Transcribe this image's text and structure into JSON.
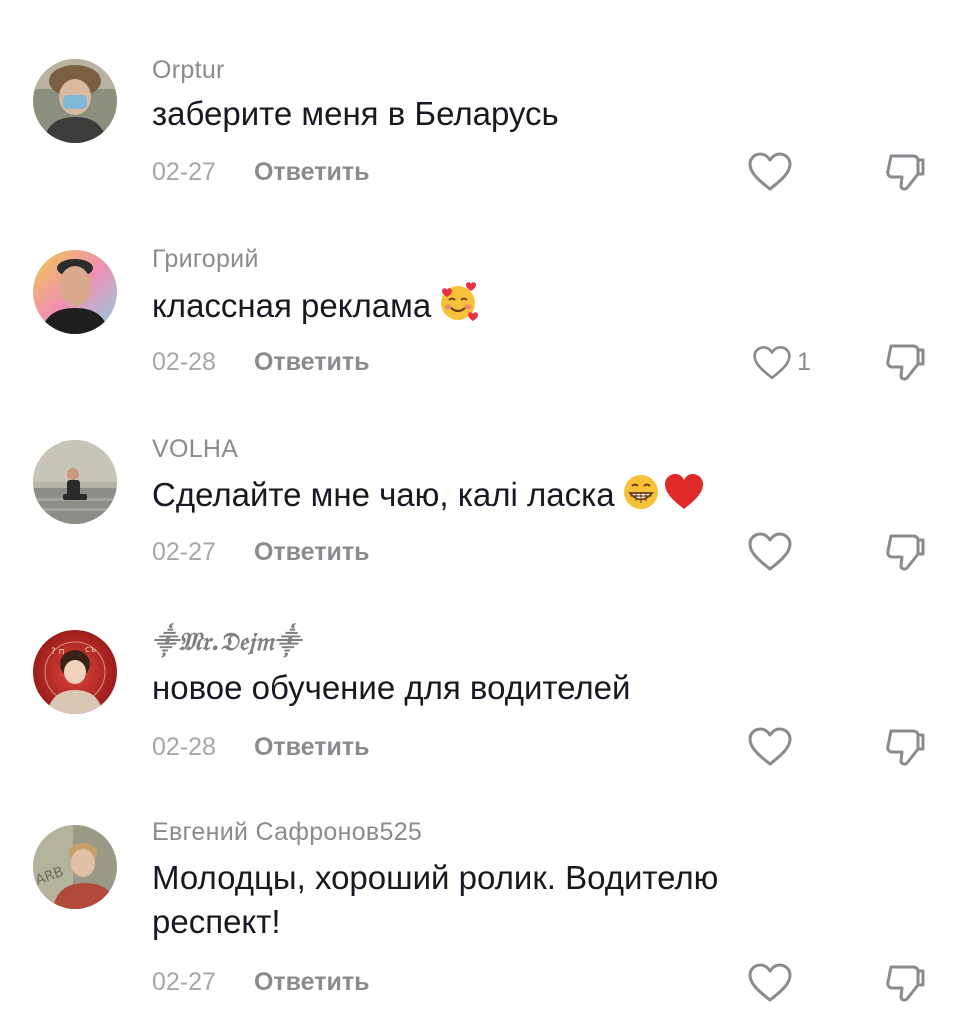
{
  "comments": [
    {
      "username": "Orptur",
      "text": "заберите меня в Беларусь",
      "date": "02-27",
      "reply_label": "Ответить",
      "like_count": "",
      "emojis": []
    },
    {
      "username": "Григорий",
      "text": "классная реклама",
      "date": "02-28",
      "reply_label": "Ответить",
      "like_count": "1",
      "emojis": [
        "smiling-face-with-hearts"
      ]
    },
    {
      "username": "VOLHA",
      "text": "Сделайте мне чаю, калі ласка",
      "date": "02-27",
      "reply_label": "Ответить",
      "like_count": "",
      "emojis": [
        "grinning-face",
        "red-heart"
      ]
    },
    {
      "username": "𝔐𝔯.𝔇𝔢𝔧𝔪",
      "text": "новое обучение для водителей",
      "date": "02-28",
      "reply_label": "Ответить",
      "like_count": "",
      "emojis": []
    },
    {
      "username": "Евгений Сафронов525",
      "text": "Молодцы, хороший ролик. Водителю респект!",
      "date": "02-27",
      "reply_label": "Ответить",
      "like_count": "",
      "emojis": []
    }
  ],
  "colors": {
    "username": "#8a8b91",
    "text": "#161823",
    "date": "#a6a7ab",
    "icon": "#8a8b91"
  },
  "icons": {
    "like": "heart-outline-icon",
    "dislike": "thumbs-down-outline-icon"
  }
}
